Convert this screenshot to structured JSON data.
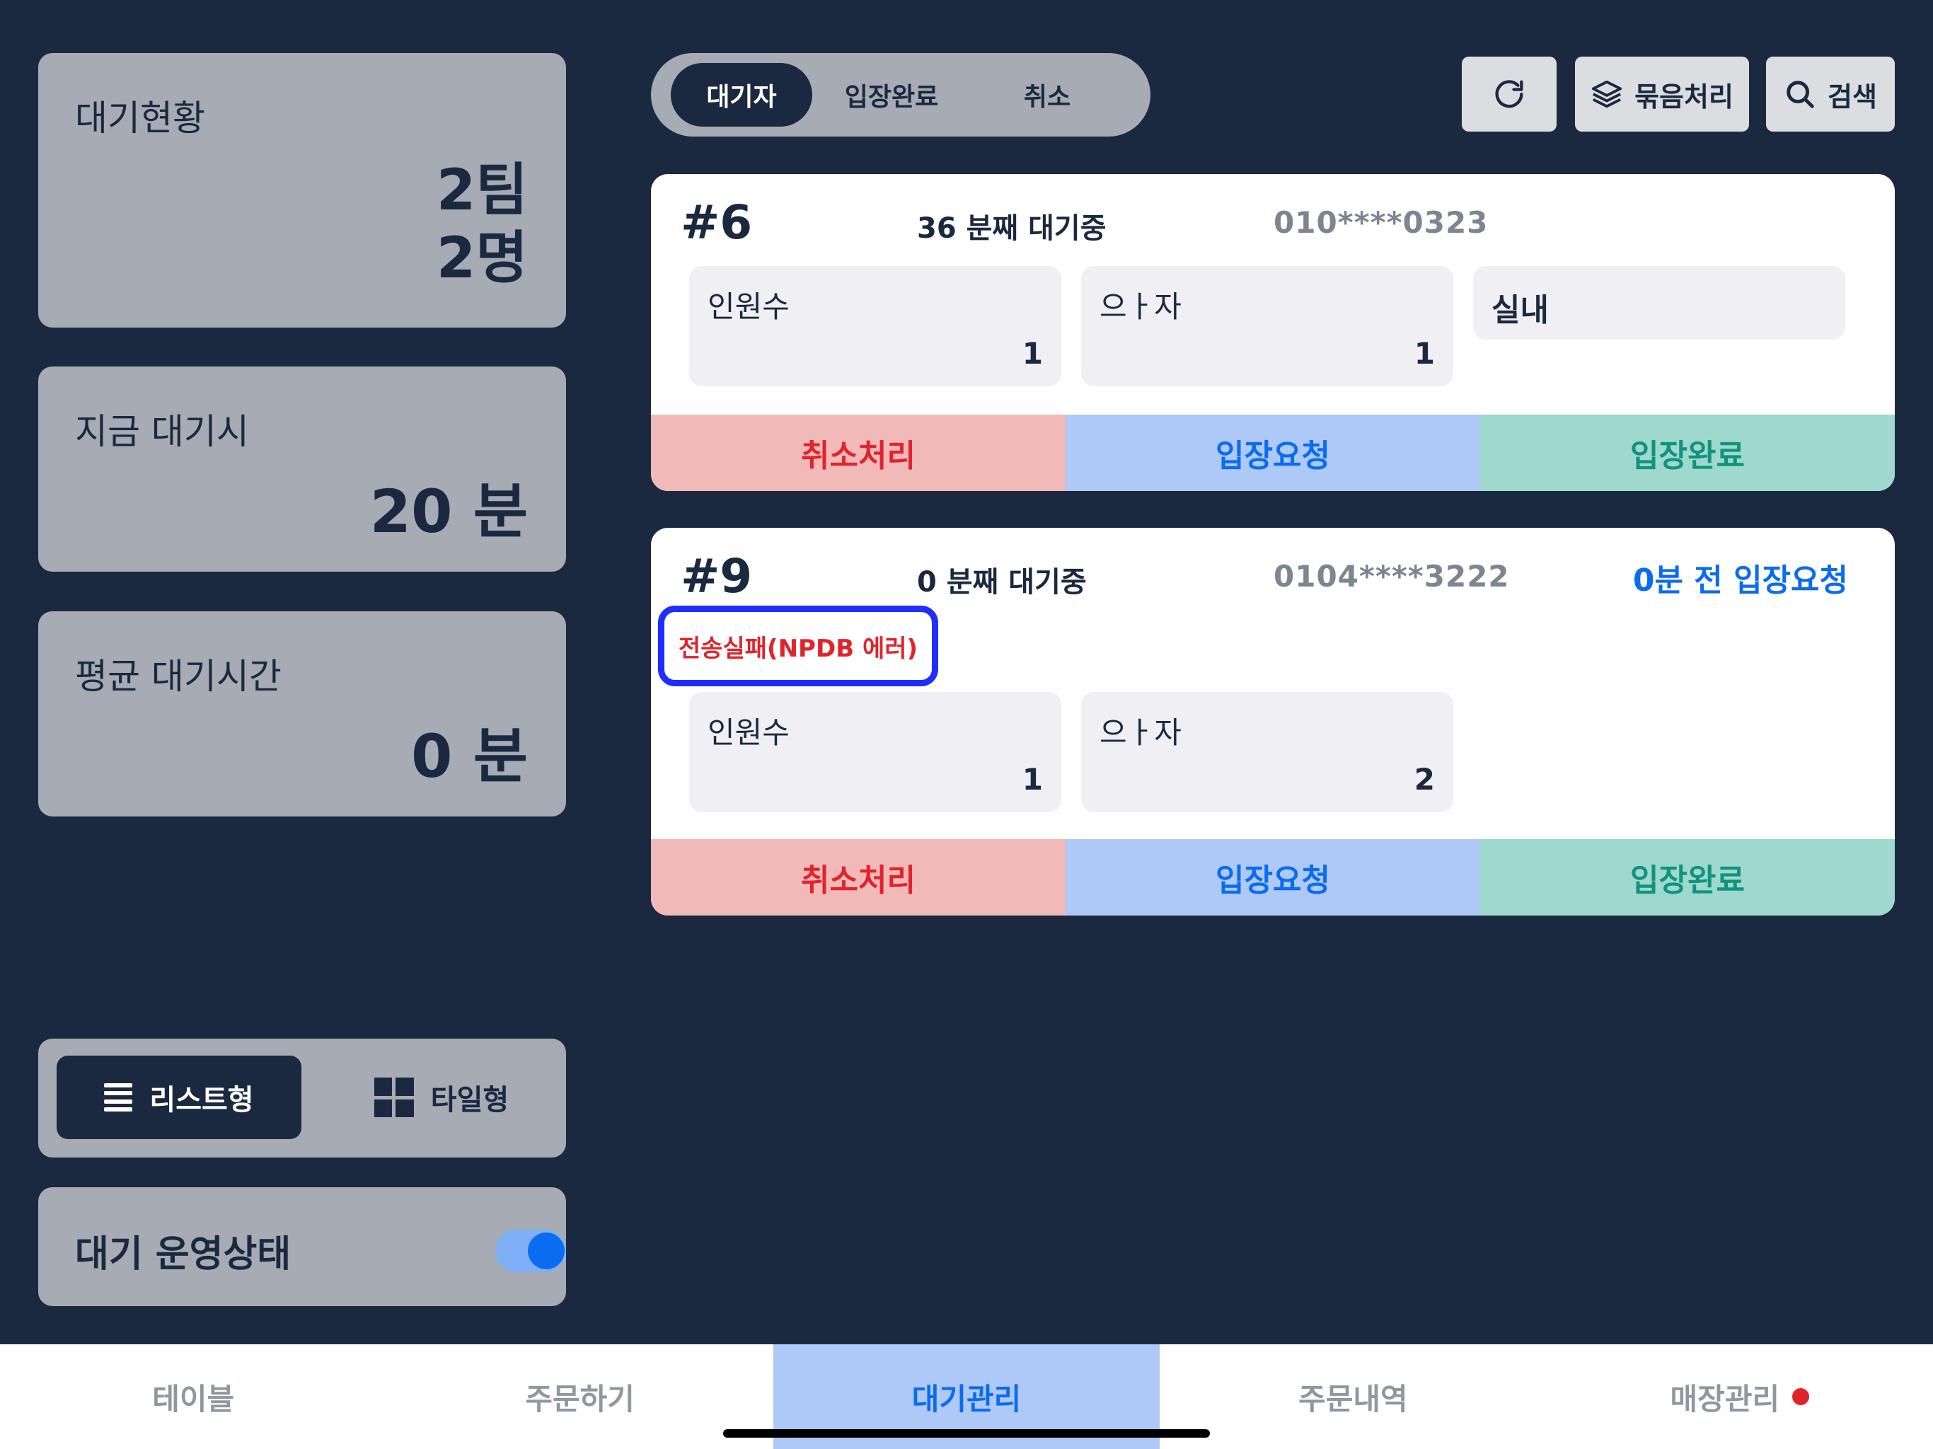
{
  "stats": {
    "status": {
      "title": "대기현황",
      "teams": "2팀",
      "people": "2명"
    },
    "now": {
      "title": "지금 대기시",
      "value": "20 분"
    },
    "avg": {
      "title": "평균 대기시간",
      "value": "0 분"
    }
  },
  "view_toggle": {
    "list_label": "리스트형",
    "tile_label": "타일형",
    "selected": "리스트형"
  },
  "operation": {
    "label": "대기 운영상태",
    "enabled": true
  },
  "segments": [
    "대기자",
    "입장완료",
    "취소"
  ],
  "segment_selected": "대기자",
  "toolbar": {
    "refresh_icon": "refresh-icon",
    "bundle_label": "묶음처리",
    "search_label": "검색"
  },
  "waiting": [
    {
      "number": "#6",
      "wait_text": "36 분째 대기중",
      "phone": "010****0323",
      "request_text": "",
      "error_text": "",
      "box_a": {
        "label": "인원수",
        "value": "1"
      },
      "box_b": {
        "label": "으ㅏ자",
        "value": "1"
      },
      "tag": "실내",
      "actions": {
        "cancel": "취소처리",
        "request": "입장요청",
        "done": "입장완료"
      }
    },
    {
      "number": "#9",
      "wait_text": "0 분째 대기중",
      "phone": "0104****3222",
      "request_text": "0분 전 입장요청",
      "error_text": "전송실패(NPDB 에러)",
      "box_a": {
        "label": "인원수",
        "value": "1"
      },
      "box_b": {
        "label": "으ㅏ자",
        "value": "2"
      },
      "tag": "",
      "actions": {
        "cancel": "취소처리",
        "request": "입장요청",
        "done": "입장완료"
      }
    }
  ],
  "tabbar": {
    "items": [
      "테이블",
      "주문하기",
      "대기관리",
      "주문내역",
      "매장관리"
    ],
    "active": "대기관리"
  },
  "colors": {
    "background": "#1b2940",
    "panel": "#a6abb4",
    "accent": "#0a6cf0",
    "danger": "#e0242c",
    "success": "#11937e"
  }
}
